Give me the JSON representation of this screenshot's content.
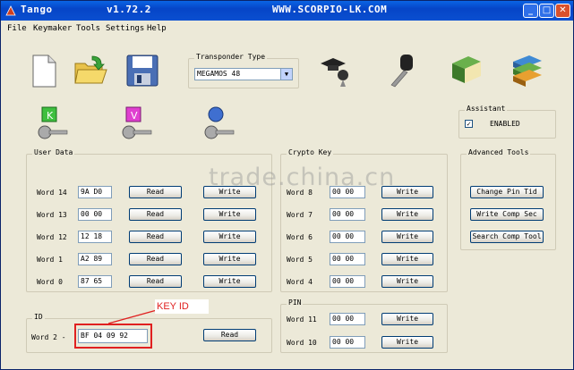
{
  "window": {
    "title": "Tango",
    "version": "v1.72.2",
    "url": "WWW.SCORPIO-LK.COM",
    "colors": {
      "titlebar": "#0a4fd0",
      "close": "#d8502b",
      "annotation": "#e02020"
    }
  },
  "menu": [
    "File",
    "Keymaker",
    "Tools",
    "Settings",
    "Help"
  ],
  "toolbar_icons": [
    "new-file-icon",
    "open-folder-icon",
    "save-disk-icon",
    "key-cap-icon",
    "key-icon",
    "book-icon",
    "books-icon"
  ],
  "transponder": {
    "label": "Transponder Type",
    "selected": "MEGAMOS 48"
  },
  "key_icons": [
    "key-k-icon",
    "key-v-icon",
    "key-globe-icon"
  ],
  "assistant": {
    "label": "Assistant",
    "checkbox_label": "ENABLED",
    "checked_mark": "✓"
  },
  "user_data": {
    "label": "User Data",
    "rows": [
      {
        "label": "Word 14",
        "value": "9A D0",
        "read": "Read",
        "write": "Write"
      },
      {
        "label": "Word 13",
        "value": "00 00",
        "read": "Read",
        "write": "Write"
      },
      {
        "label": "Word 12",
        "value": "12 18",
        "read": "Read",
        "write": "Write"
      },
      {
        "label": "Word  1",
        "value": "A2 89",
        "read": "Read",
        "write": "Write"
      },
      {
        "label": "Word  0",
        "value": "87 65",
        "read": "Read",
        "write": "Write"
      }
    ]
  },
  "crypto_key": {
    "label": "Crypto Key",
    "rows": [
      {
        "label": "Word  8",
        "value": "00 00",
        "write": "Write"
      },
      {
        "label": "Word  7",
        "value": "00 00",
        "write": "Write"
      },
      {
        "label": "Word  6",
        "value": "00 00",
        "write": "Write"
      },
      {
        "label": "Word  5",
        "value": "00 00",
        "write": "Write"
      },
      {
        "label": "Word  4",
        "value": "00 00",
        "write": "Write"
      }
    ]
  },
  "advanced_tools": {
    "label": "Advanced Tools",
    "buttons": [
      "Change Pin Tid",
      "Write Comp Sec",
      "Search Comp Tool"
    ]
  },
  "pin": {
    "label": "PIN",
    "rows": [
      {
        "label": "Word 11",
        "value": "00 00",
        "write": "Write"
      },
      {
        "label": "Word 10",
        "value": "00 00",
        "write": "Write"
      }
    ]
  },
  "id": {
    "label": "ID",
    "row_label": "Word  2 -",
    "value": "BF 04 09 92",
    "read": "Read"
  },
  "annotation": {
    "label": "KEY ID"
  },
  "watermark": "trade.china.cn"
}
